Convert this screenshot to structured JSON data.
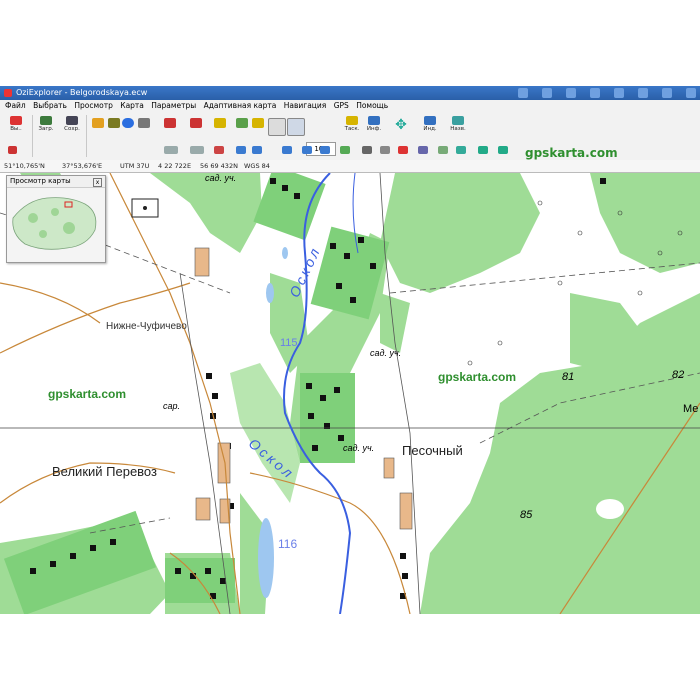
{
  "window": {
    "title": "OziExplorer - Belgorodskaya.ecw"
  },
  "menu": [
    "Файл",
    "Выбрать",
    "Просмотр",
    "Карта",
    "Параметры",
    "Адаптивная карта",
    "Навигация",
    "GPS",
    "Помощь"
  ],
  "toolbar": {
    "exit_label": "Вы..",
    "load_label": "Загр.",
    "save_label": "Сохр.",
    "zoom_value": "100",
    "track_label": "Таск.",
    "info_label": "Инф.",
    "ind_label": "Инд.",
    "name_label": "Назв.",
    "brand": "gpskarta.com"
  },
  "statusbar": {
    "lat": "51°10,765'N",
    "lon": "37°53,676'E",
    "utm_label": "UTM 37U",
    "easting": "4 22 722E",
    "northing": "56 69 432N",
    "datum": "WGS 84"
  },
  "overview": {
    "title": "Просмотр карты",
    "close": "x"
  },
  "map": {
    "river_name_1": "Оскол",
    "river_name_2": "Оскол",
    "village_1": "Нижне-Чуфичево",
    "village_2": "Великий Перевоз",
    "village_3": "Песочный",
    "garden_label": "сад. уч.",
    "shed_label": "сар.",
    "watermark": "gpskarta.com",
    "elev_115": "115",
    "elev_116": "116",
    "elev_81": "81",
    "elev_82": "82",
    "elev_85": "85",
    "edge_text": "Ме",
    "colors": {
      "forest": "#9fdc96",
      "river": "#3a5fe0",
      "road": "#c8883a",
      "water": "#9ec7f0"
    }
  }
}
